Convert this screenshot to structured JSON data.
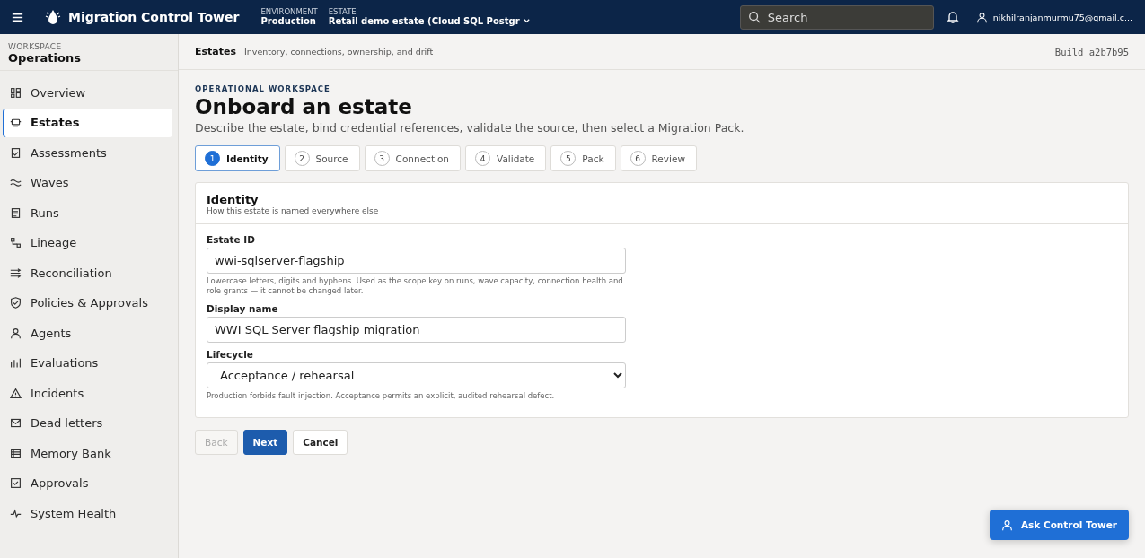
{
  "topbar": {
    "app_title": "Migration Control Tower",
    "environment": {
      "label": "ENVIRONMENT",
      "value": "Production"
    },
    "estate": {
      "label": "ESTATE",
      "value": "Retail demo estate (Cloud SQL Postgr"
    },
    "search": {
      "placeholder": "Search"
    },
    "user": "nikhilranjanmurmu75@gmail.c..."
  },
  "sidebar": {
    "eyebrow": "WORKSPACE",
    "title": "Operations",
    "items": [
      {
        "label": "Overview",
        "selected": false
      },
      {
        "label": "Estates",
        "selected": true
      },
      {
        "label": "Assessments",
        "selected": false
      },
      {
        "label": "Waves",
        "selected": false
      },
      {
        "label": "Runs",
        "selected": false
      },
      {
        "label": "Lineage",
        "selected": false
      },
      {
        "label": "Reconciliation",
        "selected": false
      },
      {
        "label": "Policies & Approvals",
        "selected": false
      },
      {
        "label": "Agents",
        "selected": false
      },
      {
        "label": "Evaluations",
        "selected": false
      },
      {
        "label": "Incidents",
        "selected": false
      },
      {
        "label": "Dead letters",
        "selected": false
      },
      {
        "label": "Memory Bank",
        "selected": false
      },
      {
        "label": "Approvals",
        "selected": false
      },
      {
        "label": "System Health",
        "selected": false
      }
    ]
  },
  "header": {
    "title": "Estates",
    "subtitle": "Inventory, connections, ownership, and drift",
    "build": "Build a2b7b95"
  },
  "page": {
    "eyebrow": "OPERATIONAL WORKSPACE",
    "title": "Onboard an estate",
    "description": "Describe the estate, bind credential references, validate the source, then select a Migration Pack."
  },
  "steps": [
    {
      "number": "1",
      "label": "Identity",
      "selected": true
    },
    {
      "number": "2",
      "label": "Source",
      "selected": false
    },
    {
      "number": "3",
      "label": "Connection",
      "selected": false
    },
    {
      "number": "4",
      "label": "Validate",
      "selected": false
    },
    {
      "number": "5",
      "label": "Pack",
      "selected": false
    },
    {
      "number": "6",
      "label": "Review",
      "selected": false
    }
  ],
  "card": {
    "title": "Identity",
    "subtitle": "How this estate is named everywhere else",
    "fields": [
      {
        "kind": "text",
        "label": "Estate ID",
        "value": "wwi-sqlserver-flagship",
        "help": "Lowercase letters, digits and hyphens. Used as the scope key on runs, wave capacity, connection health and role grants — it cannot be changed later."
      },
      {
        "kind": "text",
        "label": "Display name",
        "value": "WWI SQL Server flagship migration"
      },
      {
        "kind": "select",
        "label": "Lifecycle",
        "value": "Acceptance / rehearsal",
        "help": "Production forbids fault injection. Acceptance permits an explicit, audited rehearsal defect."
      }
    ]
  },
  "actions": [
    {
      "label": "Back",
      "kind": "secondary",
      "disabled": true
    },
    {
      "label": "Next",
      "kind": "primary",
      "disabled": false
    },
    {
      "label": "Cancel",
      "kind": "secondary",
      "disabled": false
    }
  ],
  "assistant_button": "Ask Control Tower"
}
